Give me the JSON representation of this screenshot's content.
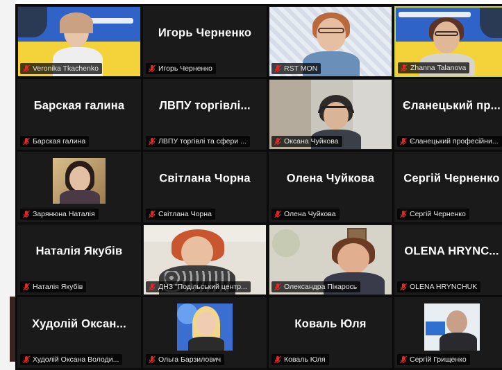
{
  "participants": [
    {
      "id": "veronika",
      "tag": "Veronika Tkachenko",
      "display": "",
      "video": "ua-flag-woman"
    },
    {
      "id": "igor",
      "tag": "Игорь Черненко",
      "display": "Игорь Черненко",
      "video": ""
    },
    {
      "id": "rst",
      "tag": "RST MON",
      "display": "",
      "video": "woman-glasses"
    },
    {
      "id": "zhanna",
      "tag": "Zhanna Talanova",
      "display": "",
      "video": "ua-flag-woman-2"
    },
    {
      "id": "barska",
      "tag": "Барская галина",
      "display": "Барская галина",
      "video": ""
    },
    {
      "id": "lvpu",
      "tag": "ЛВПУ торгівлі та сфери ...",
      "display": "ЛВПУ торгівлі...",
      "video": ""
    },
    {
      "id": "oksana-ch",
      "tag": "Оксана Чуйкова",
      "display": "",
      "video": "girl-headphones"
    },
    {
      "id": "yelanets",
      "tag": "Єланецький професійни...",
      "display": "Єланецький пр...",
      "video": ""
    },
    {
      "id": "zarian",
      "tag": "Зарянюна Наталія",
      "display": "",
      "video": "small-photo-woman"
    },
    {
      "id": "svitlana",
      "tag": "Світлана Чорна",
      "display": "Світлана Чорна",
      "video": ""
    },
    {
      "id": "olena-ch",
      "tag": "Олена Чуйкова",
      "display": "Олена Чуйкова",
      "video": ""
    },
    {
      "id": "serhii-ch",
      "tag": "Сергій Черненко",
      "display": "Сергій Черненко",
      "video": ""
    },
    {
      "id": "nataliia",
      "tag": "Наталія Якубів",
      "display": "Наталія Якубів",
      "video": ""
    },
    {
      "id": "dnz",
      "tag": "ДНЗ \"Подільський центр...",
      "display": "",
      "video": "woman-red-hair"
    },
    {
      "id": "oleksandra",
      "tag": "Олександра Пікарось",
      "display": "",
      "video": "woman-room"
    },
    {
      "id": "olena-h",
      "tag": "OLENA HRYNCHUK",
      "display": "OLENA HRYNC...",
      "video": ""
    },
    {
      "id": "khudolii",
      "tag": "Худолій Оксана Володи...",
      "display": "Худолій Оксан...",
      "video": ""
    },
    {
      "id": "olha",
      "tag": "Ольга Барзилович",
      "display": "",
      "video": "small-photo-blonde"
    },
    {
      "id": "koval",
      "tag": "Коваль Юля",
      "display": "Коваль Юля",
      "video": ""
    },
    {
      "id": "serhii-hr",
      "tag": "Сергій Грищенко",
      "display": "",
      "video": "small-photo-man"
    }
  ],
  "icons": {
    "mic_muted": "mic-muted-icon"
  },
  "colors": {
    "active_border": "#c9d84a",
    "mic_red": "#e02828",
    "tile_bg": "#1a1a1a"
  }
}
